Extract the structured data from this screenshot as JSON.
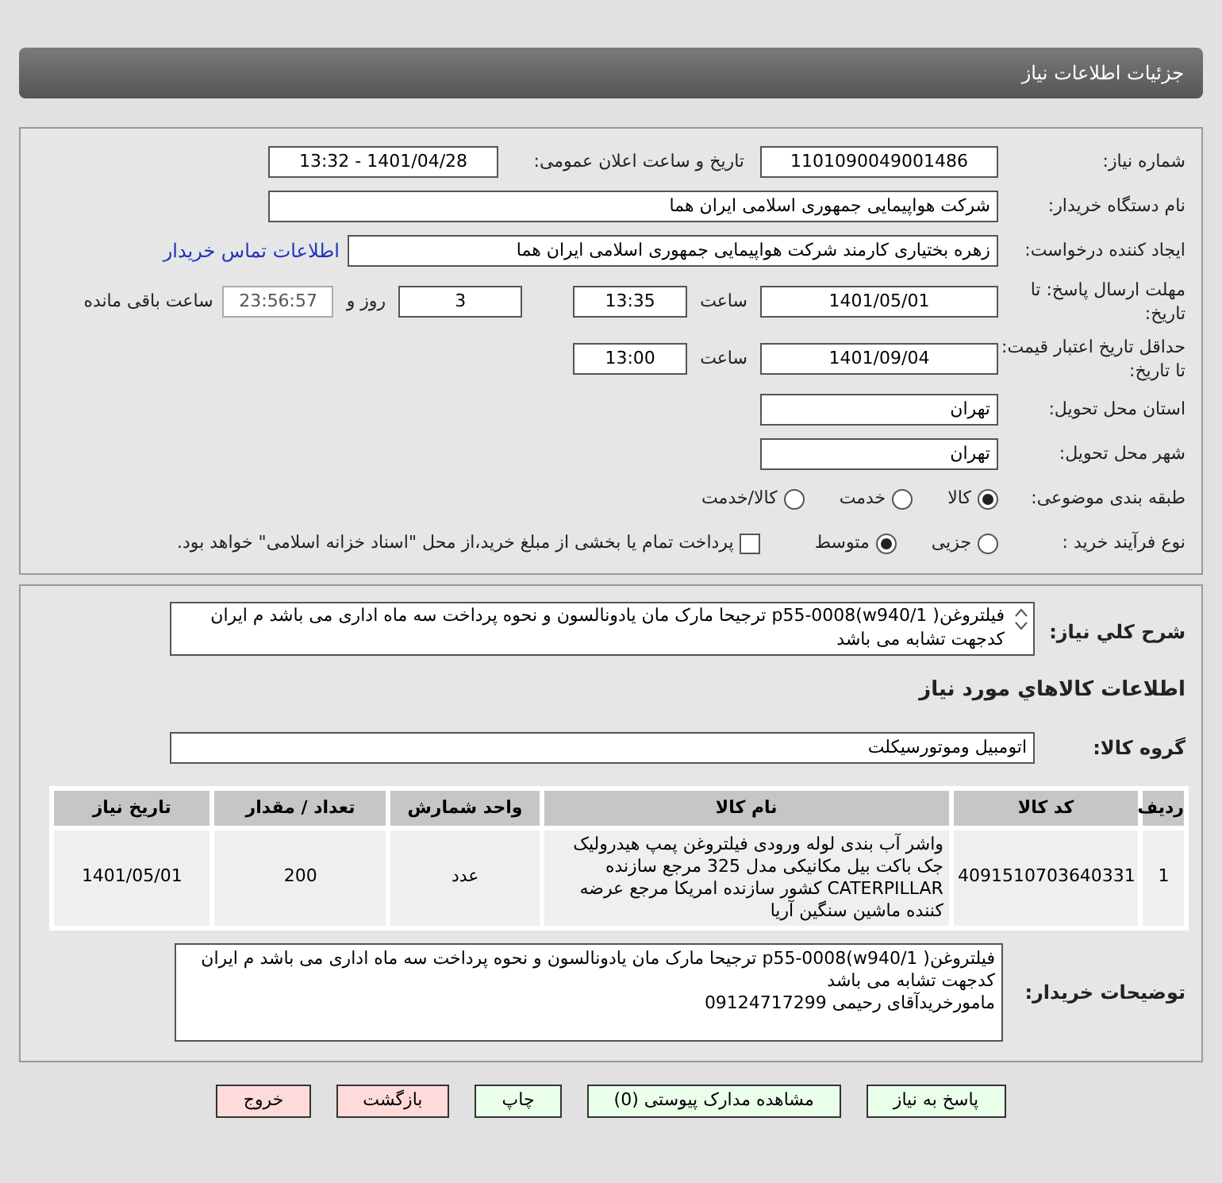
{
  "header": {
    "title": "جزئیات اطلاعات نیاز"
  },
  "info": {
    "need_number": {
      "label": "شماره نیاز:",
      "value": "1101090049001486"
    },
    "announce": {
      "label": "تاریخ و ساعت اعلان عمومی:",
      "value": "1401/04/28 - 13:32"
    },
    "buyer": {
      "label": "نام دستگاه خریدار:",
      "value": "شرکت هواپیمایی جمهوری اسلامی ایران هما"
    },
    "creator": {
      "label": "ایجاد کننده درخواست:",
      "value": "زهره بختیاری کارمند شرکت هواپیمایی جمهوری اسلامی ایران هما",
      "link": "اطلاعات تماس خریدار"
    },
    "deadline": {
      "label": "مهلت ارسال پاسخ: تا تاریخ:",
      "date": "1401/05/01",
      "time_label": "ساعت",
      "time": "13:35",
      "days": "3",
      "days_label": "روز و",
      "remaining": "23:56:57",
      "remaining_label": "ساعت باقی مانده"
    },
    "validity": {
      "label": "حداقل تاریخ اعتبار قیمت: تا تاریخ:",
      "date": "1401/09/04",
      "time_label": "ساعت",
      "time": "13:00"
    },
    "province": {
      "label": "استان محل تحویل:",
      "value": "تهران"
    },
    "city": {
      "label": "شهر محل تحویل:",
      "value": "تهران"
    },
    "category": {
      "label": "طبقه بندی موضوعی:",
      "options": [
        {
          "label": "کالا",
          "selected": true
        },
        {
          "label": "خدمت",
          "selected": false
        },
        {
          "label": "کالا/خدمت",
          "selected": false
        }
      ]
    },
    "process": {
      "label": "نوع فرآیند خرید :",
      "options": [
        {
          "label": "جزیی",
          "selected": false
        },
        {
          "label": "متوسط",
          "selected": true
        }
      ],
      "treasury": {
        "label": "پرداخت تمام یا بخشی از مبلغ خرید،از محل \"اسناد خزانه اسلامی\" خواهد بود.",
        "checked": false
      }
    }
  },
  "details": {
    "description": {
      "label": "شرح کلي نياز:",
      "value": "فیلتروغن(  p55-0008(w940/1 ترجیحا مارک مان یادونالسون و نحوه پرداخت سه ماه اداری می باشد م ایران کدجهت تشابه می باشد"
    },
    "goods_title": "اطلاعات کالاهاي مورد نياز",
    "group": {
      "label": "گروه کالا:",
      "value": "اتومبیل وموتورسیکلت"
    },
    "table": {
      "columns": [
        "ردیف",
        "کد کالا",
        "نام کالا",
        "واحد شمارش",
        "تعداد / مقدار",
        "تاریخ نیاز"
      ],
      "rows": [
        [
          "1",
          "4091510703640331",
          "واشر آب بندی لوله ورودی فیلتروغن پمپ هیدرولیک جک باکت بیل مکانیکی مدل 325 مرجع سازنده CATERPILLAR کشور سازنده امریکا مرجع عرضه کننده ماشین سنگین آریا",
          "عدد",
          "200",
          "1401/05/01"
        ]
      ]
    },
    "buyer_notes": {
      "label": "توضیحات خریدار:",
      "lines": [
        "فیلتروغن(  p55-0008(w940/1 ترجیحا مارک مان یادونالسون و نحوه پرداخت سه ماه اداری می باشد م ایران کدجهت تشابه می باشد",
        "مامورخریدآقای رحیمی 09124717299"
      ]
    }
  },
  "buttons": [
    {
      "label": "پاسخ به نیاز",
      "kind": "action"
    },
    {
      "label": "مشاهده مدارک پیوستی (0)",
      "kind": "action"
    },
    {
      "label": "چاپ",
      "kind": "action"
    },
    {
      "label": "بازگشت",
      "kind": "nav"
    },
    {
      "label": "خروج",
      "kind": "nav"
    }
  ]
}
